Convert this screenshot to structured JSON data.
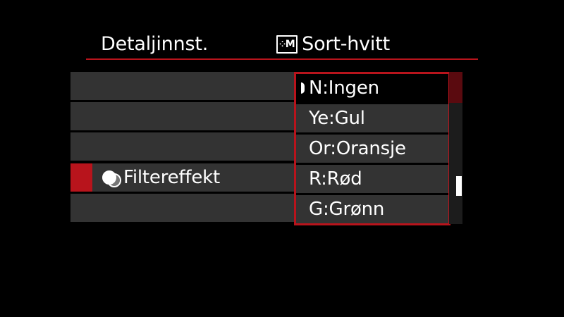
{
  "header": {
    "title": "Detaljinnst.",
    "style_icon": {
      "name": "picture-style-monochrome-icon",
      "text": "M"
    },
    "style_label": "Sort-hvitt"
  },
  "settings": {
    "rows": [
      {
        "label": ""
      },
      {
        "label": ""
      },
      {
        "label": ""
      },
      {
        "label": "Filtereffekt",
        "icon": "filter-effect-icon",
        "active": true
      },
      {
        "label": ""
      }
    ]
  },
  "dropdown": {
    "selected_index": 0,
    "options": [
      {
        "label": "N:Ingen"
      },
      {
        "label": "Ye:Gul"
      },
      {
        "label": "Or:Oransje"
      },
      {
        "label": "R:Rød"
      },
      {
        "label": "G:Grønn"
      }
    ]
  },
  "colors": {
    "accent": "#b8141c",
    "background": "#000000",
    "row_background": "#333333",
    "text": "#ffffff"
  }
}
